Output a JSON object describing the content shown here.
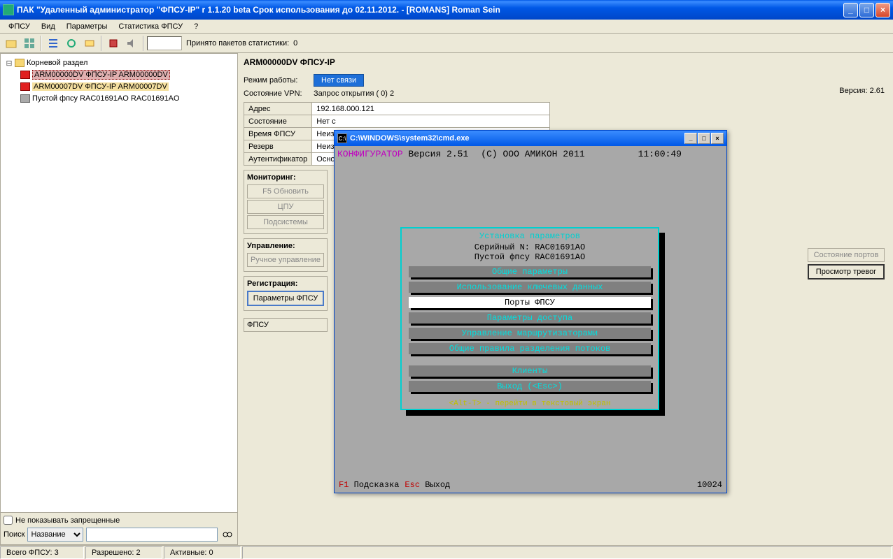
{
  "titlebar": {
    "title": "ПАК \"Удаленный администратор \"ФПСУ-IP\" r 1.1.20 beta  Срок использования до 02.11.2012. - [ROMANS] Roman Sein"
  },
  "menu": [
    "ФПСУ",
    "Вид",
    "Параметры",
    "Статистика ФПСУ",
    "?"
  ],
  "toolbar": {
    "stat_label": "Принято пакетов статистики:",
    "stat_value": "0"
  },
  "tree": {
    "root": "Корневой раздел",
    "items": [
      {
        "label": "ARM00000DV ФПСУ-IP ARM00000DV",
        "icon": "red",
        "sel": true
      },
      {
        "label": "ARM00007DV ФПСУ-IP ARM00007DV",
        "icon": "red",
        "sel2": true
      },
      {
        "label": "Пустой фпсу RAC01691AO RAC01691AO",
        "icon": "grey"
      }
    ]
  },
  "left_bottom": {
    "chk": "Не показывать запрещенные",
    "search_lbl": "Поиск",
    "search_mode": "Название"
  },
  "detail": {
    "header": "ARM00000DV ФПСУ-IP",
    "mode_lbl": "Режим работы:",
    "mode_val": "Нет связи",
    "version_lbl": "Версия: 2.61",
    "vpn_lbl": "Состояние VPN:",
    "vpn_val": "Запрос открытия ( 0) 2",
    "table": [
      [
        "Адрес",
        "192.168.000.121"
      ],
      [
        "Состояние",
        "Нет с"
      ],
      [
        "Время ФПСУ",
        "Неиз"
      ],
      [
        "Резерв",
        "Неиз"
      ],
      [
        "Аутентификатор",
        "Осно"
      ]
    ],
    "monitoring": {
      "title": "Мониторинг:",
      "buttons": [
        "F5 Обновить",
        "ЦПУ",
        "Подсистемы"
      ]
    },
    "control": {
      "title": "Управление:",
      "btn": "Ручное управление"
    },
    "registration": {
      "title": "Регистрация:",
      "btn": "Параметры ФПСУ"
    },
    "fpsu_box": "ФПСУ",
    "side_buttons": [
      {
        "label": "Состояние портов",
        "disabled": true
      },
      {
        "label": "Просмотр тревог",
        "bold": true
      }
    ]
  },
  "cmd": {
    "title": "C:\\WINDOWS\\system32\\cmd.exe",
    "header": {
      "cfg": "КОНФИГУРАТОР",
      "ver": "Версия 2.51",
      "cp": "(С) ООО АМИКОН 2011",
      "time": "11:00:49"
    },
    "frame_title": "Установка параметров",
    "serial1": "Серийный N: RAC01691AO",
    "serial2": "Пустой фпсу RAC01691AO",
    "menu": [
      {
        "label": "Общие параметры"
      },
      {
        "label": "Использование ключевых данных"
      },
      {
        "label": "Порты ФПСУ",
        "selected": true
      },
      {
        "label": "Параметры доступа"
      },
      {
        "label": "Управление маршрутизаторами"
      },
      {
        "label": "Общие правила разделения потоков"
      },
      {
        "label": "Клиенты"
      },
      {
        "label": "Выход (<Esc>)"
      }
    ],
    "hint": "<Alt-T> - перейти в текстовый экран",
    "footer": {
      "f1": "F1",
      "f1t": "Подсказка",
      "esc": "Esc",
      "esct": "Выход",
      "num": "10024"
    }
  },
  "statusbar": {
    "total": "Всего ФПСУ: 3",
    "allowed": "Разрешено: 2",
    "active": "Активные: 0"
  }
}
